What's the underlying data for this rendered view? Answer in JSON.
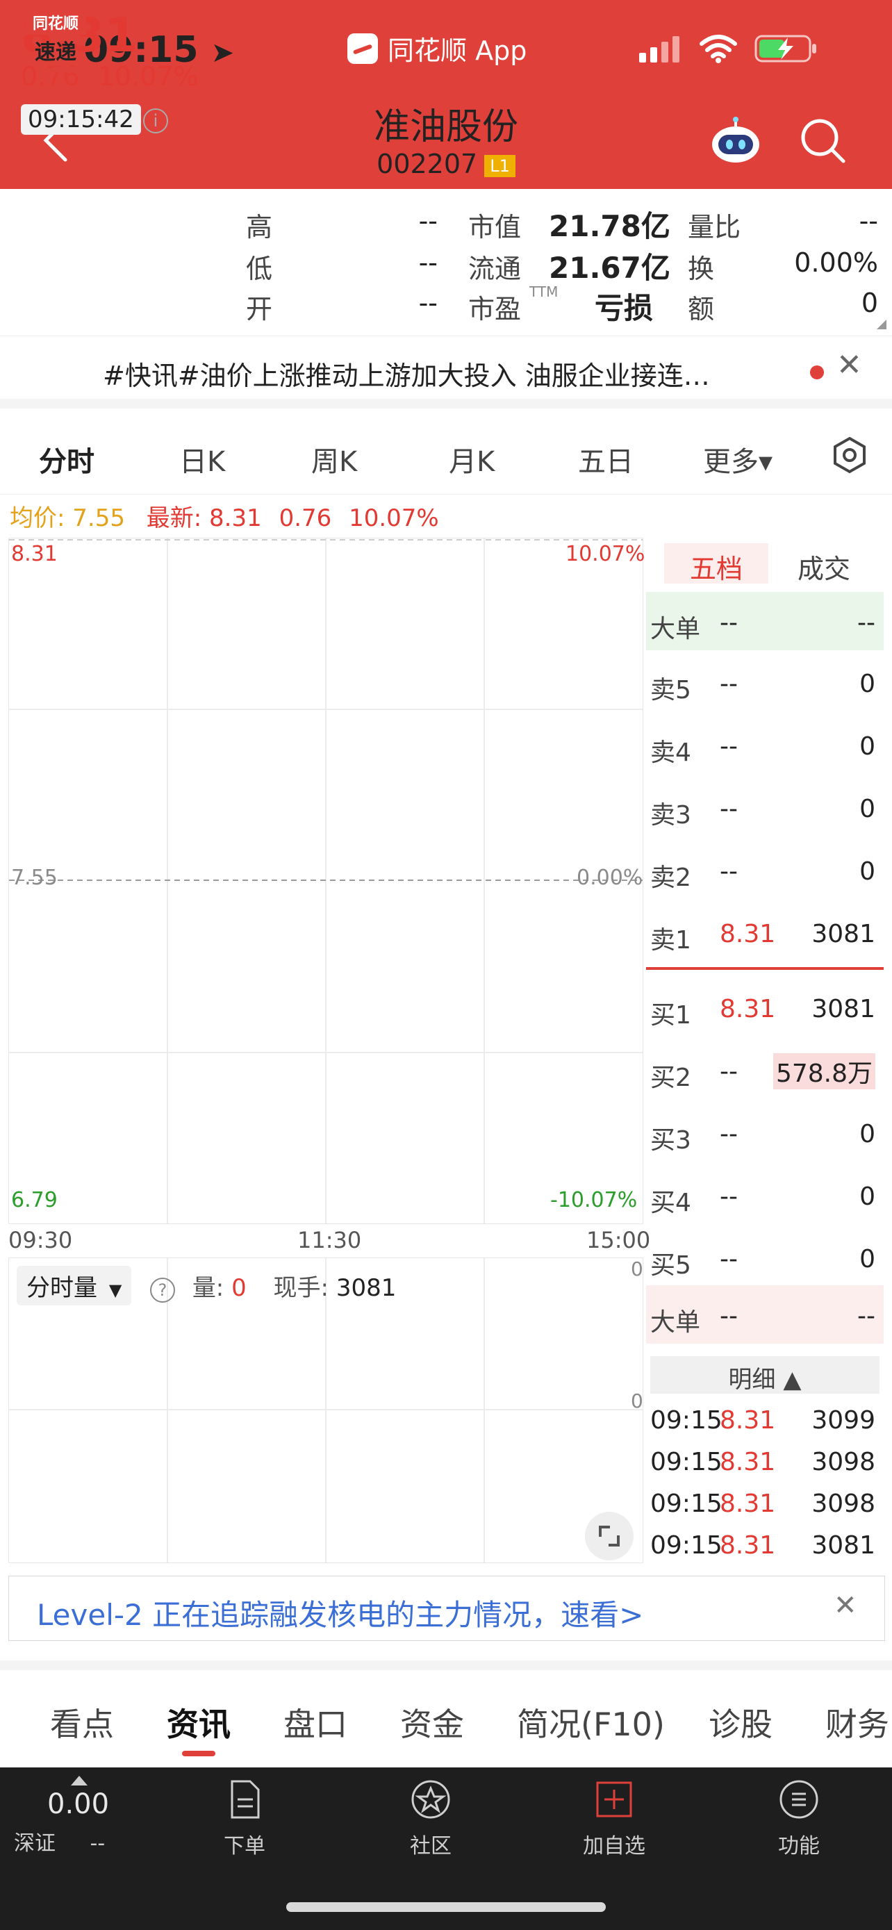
{
  "status_bar": {
    "time": "09:15",
    "app": "同花顺 App"
  },
  "header": {
    "stock_name": "准油股份",
    "stock_code": "002207",
    "level_badge": "L1"
  },
  "quote": {
    "price": "8.31",
    "change_abs": "0.76",
    "change_pct": "10.07%",
    "time": "09:15:42",
    "fields": [
      {
        "label": "高",
        "value": "--"
      },
      {
        "label": "低",
        "value": "--"
      },
      {
        "label": "开",
        "value": "--"
      },
      {
        "label": "市值",
        "value": "21.78亿"
      },
      {
        "label": "流通",
        "value": "21.67亿"
      },
      {
        "label": "市盈",
        "label_sup": "TTM",
        "value": "亏损"
      },
      {
        "label": "量比",
        "value": "--"
      },
      {
        "label": "换",
        "value": "0.00%"
      },
      {
        "label": "额",
        "value": "0"
      }
    ]
  },
  "news": {
    "logo_top": "同花顺",
    "logo_bottom": "速递",
    "text": "#快讯#油价上涨推动上游加大投入 油服企业接连…"
  },
  "tabs": [
    "分时",
    "日K",
    "周K",
    "月K",
    "五日",
    "更多▾"
  ],
  "chart_header": {
    "avg_label": "均价: 7.55",
    "latest_label": "最新: 8.31",
    "change_abs": "0.76",
    "change_pct": "10.07%"
  },
  "chart": {
    "top_price": "8.31",
    "top_pct": "10.07%",
    "mid_price": "7.55",
    "mid_pct": "0.00%",
    "bottom_price": "6.79",
    "bottom_pct": "-10.07%",
    "time_start": "09:30",
    "time_mid": "11:30",
    "time_end": "15:00"
  },
  "volume": {
    "selector": "分时量",
    "vol_label": "量:",
    "vol_value": "0",
    "hand_label": "现手:",
    "hand_value": "3081",
    "axis_top": "0",
    "axis_mid": "0"
  },
  "orderbook": {
    "tab_active": "五档",
    "tab_other": "成交",
    "big_sell": {
      "label": "大单",
      "price": "--",
      "qty": "--"
    },
    "sells": [
      {
        "label": "卖5",
        "price": "--",
        "qty": "0"
      },
      {
        "label": "卖4",
        "price": "--",
        "qty": "0"
      },
      {
        "label": "卖3",
        "price": "--",
        "qty": "0"
      },
      {
        "label": "卖2",
        "price": "--",
        "qty": "0"
      },
      {
        "label": "卖1",
        "price": "8.31",
        "qty": "3081"
      }
    ],
    "buys": [
      {
        "label": "买1",
        "price": "8.31",
        "qty": "3081"
      },
      {
        "label": "买2",
        "price": "--",
        "qty": "578.8万"
      },
      {
        "label": "买3",
        "price": "--",
        "qty": "0"
      },
      {
        "label": "买4",
        "price": "--",
        "qty": "0"
      },
      {
        "label": "买5",
        "price": "--",
        "qty": "0"
      }
    ],
    "big_buy": {
      "label": "大单",
      "price": "--",
      "qty": "--"
    },
    "detail_header": "明细 ▲",
    "details": [
      {
        "time": "09:15",
        "price": "8.31",
        "qty": "3099"
      },
      {
        "time": "09:15",
        "price": "8.31",
        "qty": "3098"
      },
      {
        "time": "09:15",
        "price": "8.31",
        "qty": "3098"
      },
      {
        "time": "09:15",
        "price": "8.31",
        "qty": "3081"
      }
    ]
  },
  "promo": {
    "text": "Level-2 正在追踪融发核电的主力情况，速看>"
  },
  "section_tabs": [
    "看点",
    "资讯",
    "盘口",
    "资金",
    "简况(F10)",
    "诊股",
    "财务"
  ],
  "bottom_bar": {
    "index_value": "0.00",
    "index_name": "深证",
    "index_change": "--",
    "items": [
      "下单",
      "社区",
      "加自选",
      "功能"
    ]
  },
  "colors": {
    "brand": "#e0403a",
    "up": "#e23a32",
    "down": "#2a9d2a",
    "avg": "#e3a21a"
  }
}
